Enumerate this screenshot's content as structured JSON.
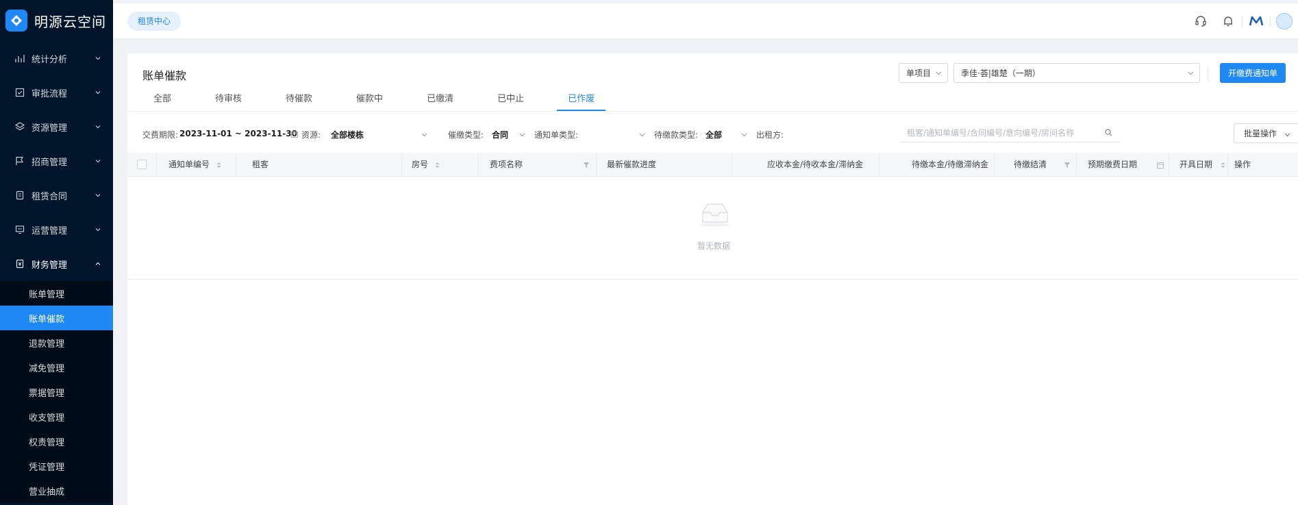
{
  "app": {
    "title": "明源云空间"
  },
  "sidebar": {
    "items": [
      {
        "label": "统计分析",
        "icon": "chart-icon"
      },
      {
        "label": "审批流程",
        "icon": "checklist-icon"
      },
      {
        "label": "资源管理",
        "icon": "layers-icon"
      },
      {
        "label": "招商管理",
        "icon": "flag-icon"
      },
      {
        "label": "租赁合同",
        "icon": "contract-icon"
      },
      {
        "label": "运营管理",
        "icon": "monitor-icon"
      },
      {
        "label": "财务管理",
        "icon": "finance-icon"
      }
    ],
    "subitems": [
      "账单管理",
      "账单催款",
      "退款管理",
      "减免管理",
      "票据管理",
      "收支管理",
      "权责管理",
      "凭证管理",
      "营业抽成"
    ],
    "active_sub": "账单催款"
  },
  "header": {
    "tag": "租赁中心"
  },
  "page": {
    "title": "账单催款",
    "tabs": [
      "全部",
      "待审核",
      "待催款",
      "催款中",
      "已缴清",
      "已中止",
      "已作废"
    ],
    "active_tab": "已作废",
    "project_select": "单项目",
    "site_select": "季佳·荟|雄楚（一期）",
    "primary_button": "开缴费通知单"
  },
  "filters": {
    "period_label": "交费期限:",
    "period_value": "2023-11-01 ~ 2023-11-30",
    "resource_label": "资源:",
    "resource_value": "全部楼栋",
    "collect_type_label": "催缴类型:",
    "collect_type_value": "合同",
    "notice_type_label": "通知单类型:",
    "pending_type_label": "待缴款类型:",
    "pending_type_value": "全部",
    "tenant_label": "出租方:",
    "search_placeholder": "租客/通知单编号/合同编号/意向编号/房间名称",
    "batch_button": "批量操作"
  },
  "table": {
    "columns": [
      "通知单编号",
      "租客",
      "房号",
      "费项名称",
      "最新催款进度",
      "应收本金/待收本金/滞纳金",
      "待缴本金/待缴滞纳金",
      "待缴结清",
      "预期缴费日期",
      "开具日期",
      "操作"
    ],
    "empty_text": "暂无数据"
  },
  "colors": {
    "accent": "#1e88f5",
    "sidebar_bg": "#001529"
  }
}
